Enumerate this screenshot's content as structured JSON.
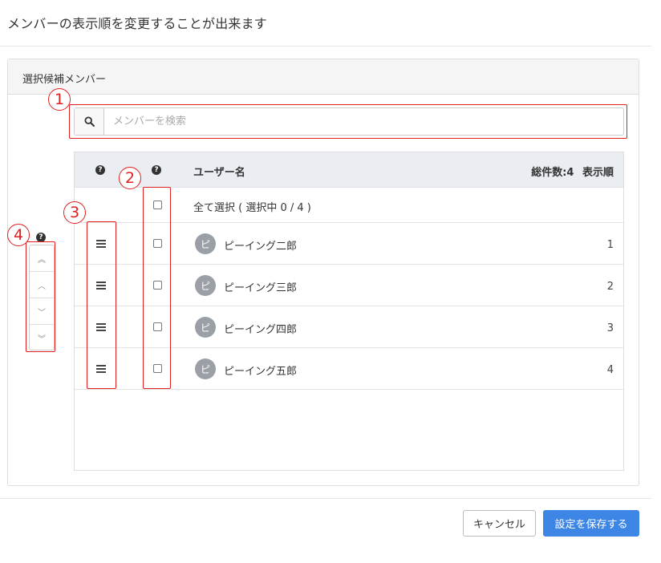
{
  "header": {
    "title": "メンバーの表示順を変更することが出来ます"
  },
  "panel": {
    "title": "選択候補メンバー"
  },
  "search": {
    "placeholder": "メンバーを検索",
    "value": ""
  },
  "table": {
    "headers": {
      "help1": "?",
      "help2": "?",
      "username": "ユーザー名",
      "count_label": "総件数:4",
      "order_label": "表示順"
    },
    "select_all_label": "全て選択 ( 選択中 0 / 4 )",
    "rows": [
      {
        "avatar": "ピ",
        "name": "ピーイング二郎",
        "order": "1"
      },
      {
        "avatar": "ピ",
        "name": "ピーイング三郎",
        "order": "2"
      },
      {
        "avatar": "ピ",
        "name": "ピーイング四郎",
        "order": "3"
      },
      {
        "avatar": "ピ",
        "name": "ピーイング五郎",
        "order": "4"
      }
    ]
  },
  "mover": {
    "help": "?",
    "top": "︽",
    "up": "︿",
    "down": "﹀",
    "bottom": "︾"
  },
  "annotations": {
    "n1": "1",
    "n2": "2",
    "n3": "3",
    "n4": "4"
  },
  "footer": {
    "cancel_label": "キャンセル",
    "save_label": "設定を保存する"
  },
  "colors": {
    "accent": "#3d86e6",
    "annotation": "#e02020",
    "avatar": "#9aa0a6"
  },
  "icons": {
    "search": "search-icon",
    "help": "question-circle-icon",
    "handle": "drag-handle-icon"
  }
}
